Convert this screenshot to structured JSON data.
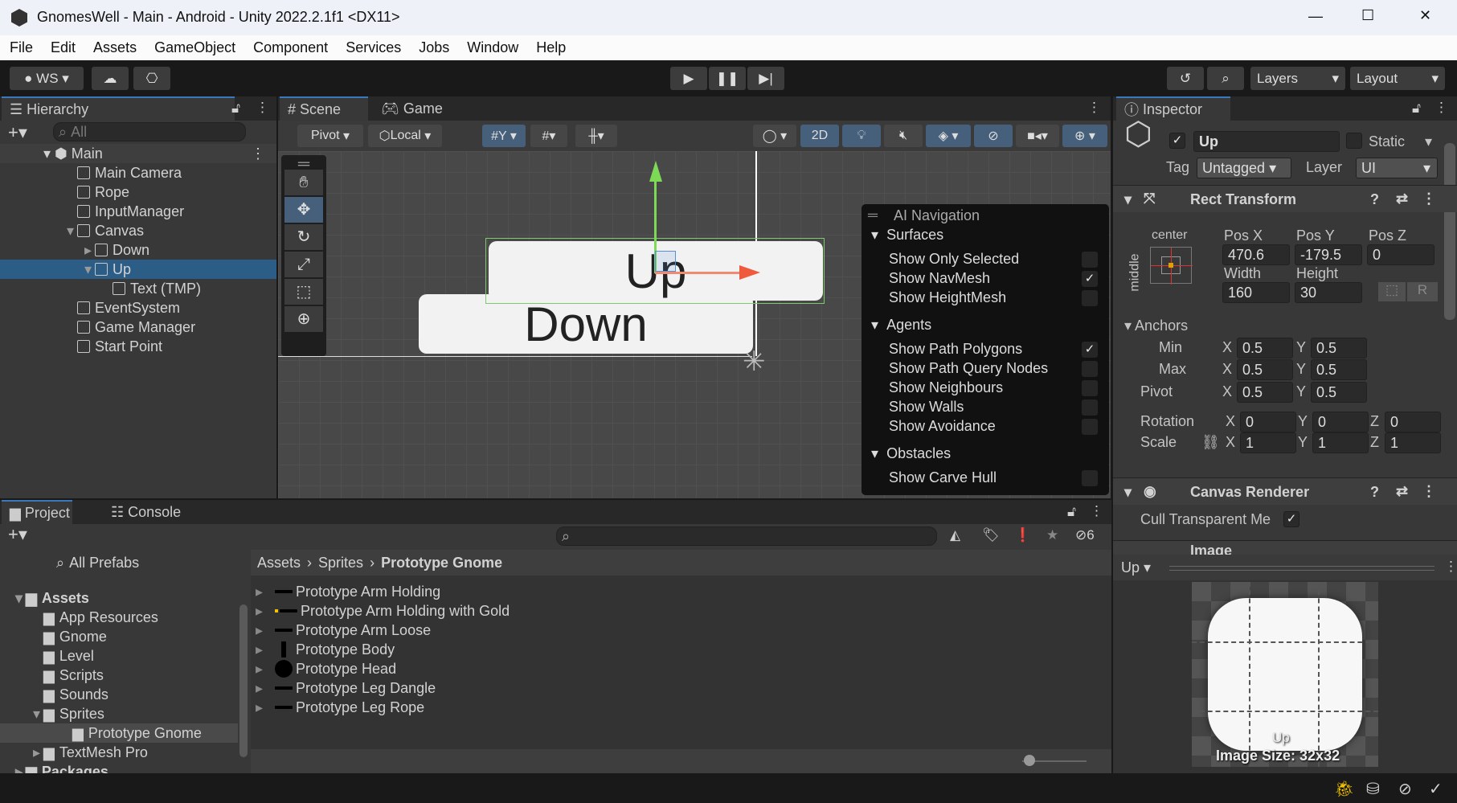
{
  "window": {
    "title": "GnomesWell - Main - Android - Unity 2022.2.1f1 <DX11>",
    "controls": [
      "—",
      "☐",
      "✕"
    ]
  },
  "menu": [
    "File",
    "Edit",
    "Assets",
    "GameObject",
    "Component",
    "Services",
    "Jobs",
    "Window",
    "Help"
  ],
  "toolbar": {
    "account": "WS",
    "layers": "Layers",
    "layout": "Layout"
  },
  "hierarchy": {
    "tab": "Hierarchy",
    "search_placeholder": "All",
    "scene": "Main",
    "items": [
      {
        "label": "Main Camera",
        "depth": 1
      },
      {
        "label": "Rope",
        "depth": 1
      },
      {
        "label": "InputManager",
        "depth": 1
      },
      {
        "label": "Canvas",
        "depth": 1,
        "expanded": true
      },
      {
        "label": "Down",
        "depth": 2,
        "collapsed": true
      },
      {
        "label": "Up",
        "depth": 2,
        "expanded": true,
        "selected": true
      },
      {
        "label": "Text (TMP)",
        "depth": 3
      },
      {
        "label": "EventSystem",
        "depth": 1
      },
      {
        "label": "Game Manager",
        "depth": 1
      },
      {
        "label": "Start Point",
        "depth": 1
      }
    ]
  },
  "scene": {
    "tabs": [
      "Scene",
      "Game"
    ],
    "pivot": "Pivot",
    "local": "Local",
    "mode_2d": "2D",
    "buttons": {
      "up": "Up",
      "down": "Down"
    }
  },
  "ai_navigation": {
    "title": "AI Navigation",
    "sections": [
      {
        "label": "Surfaces",
        "items": [
          {
            "label": "Show Only Selected",
            "checked": false
          },
          {
            "label": "Show NavMesh",
            "checked": true
          },
          {
            "label": "Show HeightMesh",
            "checked": false
          }
        ]
      },
      {
        "label": "Agents",
        "items": [
          {
            "label": "Show Path Polygons",
            "checked": true
          },
          {
            "label": "Show Path Query Nodes",
            "checked": false
          },
          {
            "label": "Show Neighbours",
            "checked": false
          },
          {
            "label": "Show Walls",
            "checked": false
          },
          {
            "label": "Show Avoidance",
            "checked": false
          }
        ]
      },
      {
        "label": "Obstacles",
        "items": [
          {
            "label": "Show Carve Hull",
            "checked": false
          }
        ]
      }
    ]
  },
  "inspector": {
    "tab": "Inspector",
    "name": "Up",
    "active": true,
    "static_label": "Static",
    "tag_label": "Tag",
    "tag": "Untagged",
    "layer_label": "Layer",
    "layer": "UI",
    "rect_transform": {
      "title": "Rect Transform",
      "anchor_h": "center",
      "anchor_v": "middle",
      "pos_x_label": "Pos X",
      "pos_y_label": "Pos Y",
      "pos_z_label": "Pos Z",
      "pos_x": "470.6",
      "pos_y": "-179.5",
      "pos_z": "0",
      "width_label": "Width",
      "height_label": "Height",
      "width": "160",
      "height": "30",
      "r_label": "R",
      "anchors_label": "Anchors",
      "min_label": "Min",
      "max_label": "Max",
      "pivot_label": "Pivot",
      "min_x": "0.5",
      "min_y": "0.5",
      "max_x": "0.5",
      "max_y": "0.5",
      "pivot_x": "0.5",
      "pivot_y": "0.5",
      "rotation_label": "Rotation",
      "scale_label": "Scale",
      "rot_x": "0",
      "rot_y": "0",
      "rot_z": "0",
      "scale_x": "1",
      "scale_y": "1",
      "scale_z": "1",
      "x": "X",
      "y": "Y",
      "z": "Z"
    },
    "canvas_renderer": {
      "title": "Canvas Renderer",
      "cull_label": "Cull Transparent Me",
      "cull": true
    },
    "image": {
      "title": "Image"
    },
    "preview": {
      "selector": "Up",
      "sprite_name": "Up",
      "size_text": "Image Size: 32x32"
    }
  },
  "project": {
    "tabs": [
      "Project",
      "Console"
    ],
    "hidden_count": "6",
    "tree": [
      {
        "label": "All Prefabs",
        "type": "search"
      },
      {
        "label": "Assets",
        "bold": true,
        "depth": 0
      },
      {
        "label": "App Resources",
        "depth": 1
      },
      {
        "label": "Gnome",
        "depth": 1
      },
      {
        "label": "Level",
        "depth": 1
      },
      {
        "label": "Scripts",
        "depth": 1
      },
      {
        "label": "Sounds",
        "depth": 1
      },
      {
        "label": "Sprites",
        "depth": 1
      },
      {
        "label": "Prototype Gnome",
        "depth": 2,
        "selected": true
      },
      {
        "label": "TextMesh Pro",
        "depth": 1
      },
      {
        "label": "Packages",
        "bold": true,
        "depth": 0
      }
    ],
    "breadcrumb": [
      "Assets",
      "Sprites",
      "Prototype Gnome"
    ],
    "items": [
      "Prototype Arm Holding",
      "Prototype Arm Holding with Gold",
      "Prototype Arm Loose",
      "Prototype Body",
      "Prototype Head",
      "Prototype Leg Dangle",
      "Prototype Leg Rope"
    ]
  },
  "colors": {
    "accent": "#3a79bb",
    "selected": "#2c5d87",
    "toggle_on": "#46607c",
    "gizmo_x": "#f05a3c",
    "gizmo_y": "#7ed957",
    "warning": "#f2c200"
  }
}
